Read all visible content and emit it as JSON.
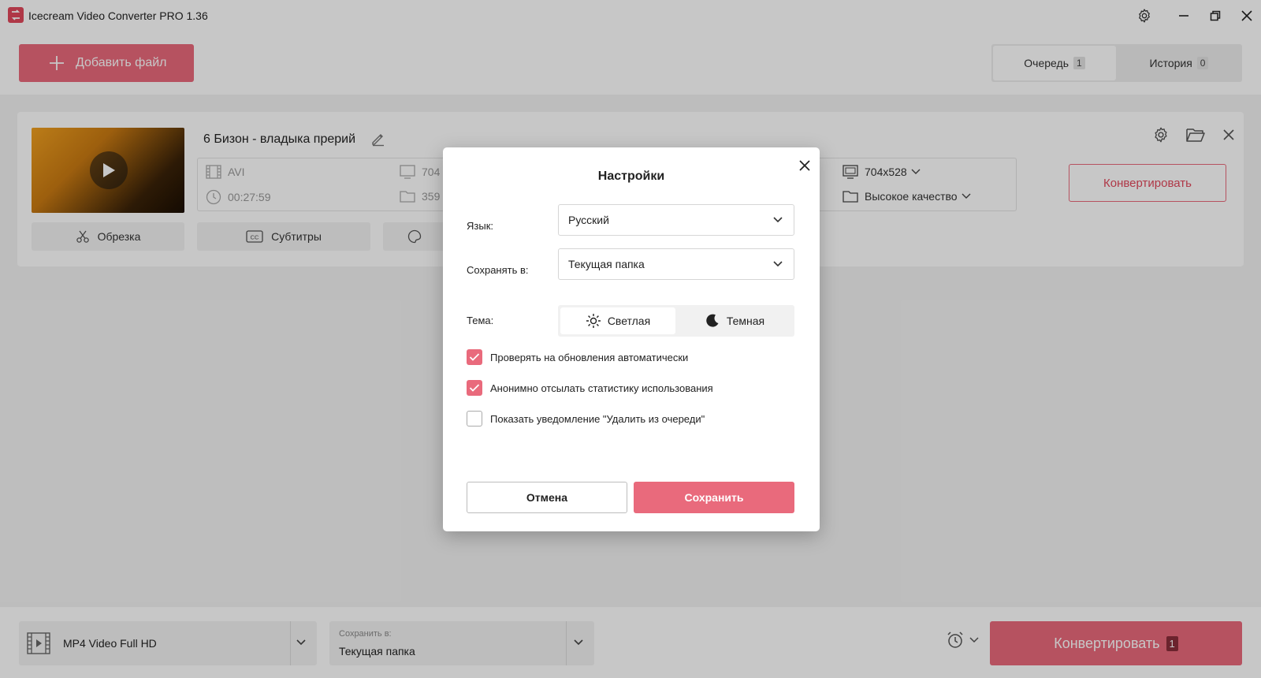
{
  "window": {
    "title": "Icecream Video Converter PRO 1.36"
  },
  "header": {
    "add_file_label": "Добавить файл",
    "tabs": [
      {
        "label": "Очередь",
        "count": "1"
      },
      {
        "label": "История",
        "count": "0"
      }
    ]
  },
  "file": {
    "title": "6 Бизон - владыка прерий",
    "format": "AVI",
    "duration": "00:27:59",
    "resolution_partial": "704",
    "size_partial": "359",
    "output_resolution": "704x528",
    "output_quality": "Высокое качество",
    "convert_label": "Конвертировать",
    "tools": [
      {
        "label": "Обрезка"
      },
      {
        "label": "Субтитры"
      }
    ]
  },
  "bottom": {
    "format_value": "MP4 Video Full HD",
    "save_to_caption": "Сохранить в:",
    "save_to_value": "Текущая папка",
    "convert_label": "Конвертировать",
    "convert_count": "1"
  },
  "dialog": {
    "title": "Настройки",
    "language_label": "Язык:",
    "language_value": "Русский",
    "save_to_label": "Сохранять в:",
    "save_to_value": "Текущая папка",
    "theme_label": "Тема:",
    "theme_light": "Светлая",
    "theme_dark": "Темная",
    "checkboxes": [
      {
        "label": "Проверять на обновления автоматически",
        "checked": true
      },
      {
        "label": "Анонимно отсылать статистику использования",
        "checked": true
      },
      {
        "label": "Показать уведомление \"Удалить из очереди\"",
        "checked": false
      }
    ],
    "cancel_label": "Отмена",
    "save_label": "Сохранить"
  },
  "colors": {
    "accent": "#e96a7c",
    "accent_dark": "#e0485c"
  }
}
